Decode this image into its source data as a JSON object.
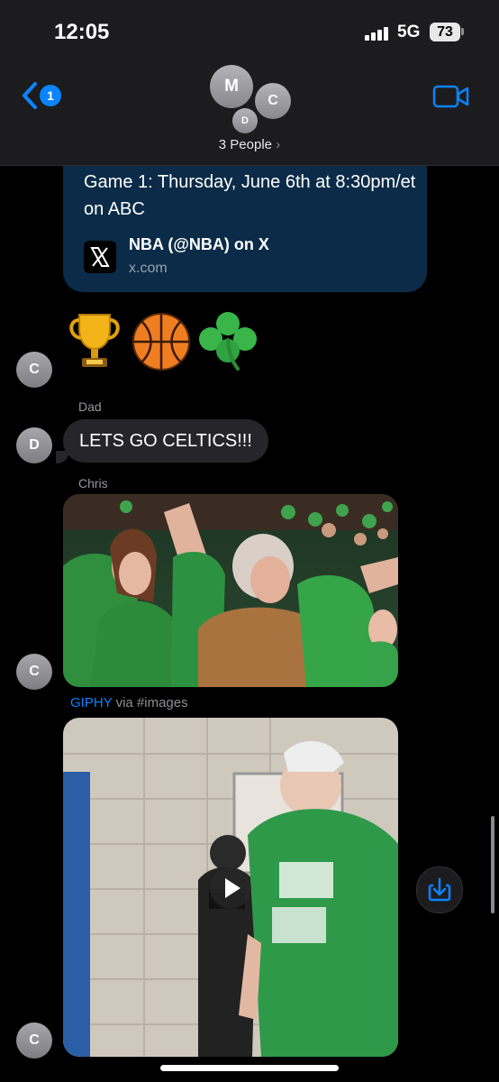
{
  "status_bar": {
    "time": "12:05",
    "network": "5G",
    "battery": "73"
  },
  "header": {
    "back_badge": "1",
    "avatars": [
      "M",
      "C",
      "D"
    ],
    "title": "3 People",
    "title_chevron": "›"
  },
  "link_preview": {
    "text": "Game 1: Thursday, June 6th at 8:30pm/et on ABC",
    "title": "NBA (@NBA) on X",
    "domain": "x.com"
  },
  "messages": {
    "emoji_sender_initial": "C",
    "emojis": [
      "trophy-icon",
      "basketball-icon",
      "shamrock-icon"
    ],
    "dad_name": "Dad",
    "dad_initial": "D",
    "dad_text": "LETS GO CELTICS!!!",
    "chris_name": "Chris",
    "chris_initial": "C",
    "gif_caption_brand": "GIPHY",
    "gif_caption_suffix": " via #images",
    "video_sender_initial": "C"
  },
  "colors": {
    "accent": "#0a84ff",
    "header_bg": "#1c1c1e",
    "link_card_bg": "#0b2b48",
    "bubble_bg": "#26252a",
    "celtics_green": "#2f9e45"
  }
}
